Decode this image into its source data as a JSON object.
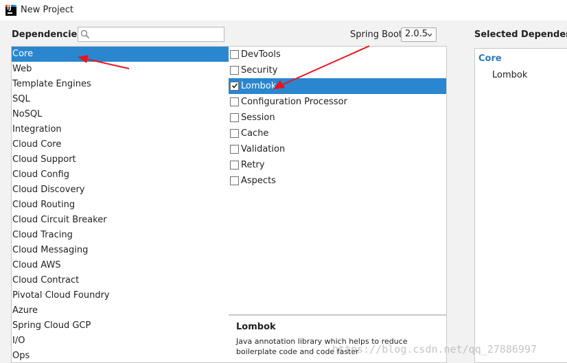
{
  "window": {
    "title": "New Project",
    "icon": "intellij-idea-icon"
  },
  "dependencies_label": "Dependencies",
  "search": {
    "value": "",
    "placeholder": ""
  },
  "spring_boot": {
    "label": "Spring Boot",
    "version": "2.0.5"
  },
  "selected_dependencies_label": "Selected Dependencies",
  "categories": [
    {
      "label": "Core",
      "selected": true
    },
    {
      "label": "Web"
    },
    {
      "label": "Template Engines"
    },
    {
      "label": "SQL"
    },
    {
      "label": "NoSQL"
    },
    {
      "label": "Integration"
    },
    {
      "label": "Cloud Core"
    },
    {
      "label": "Cloud Support"
    },
    {
      "label": "Cloud Config"
    },
    {
      "label": "Cloud Discovery"
    },
    {
      "label": "Cloud Routing"
    },
    {
      "label": "Cloud Circuit Breaker"
    },
    {
      "label": "Cloud Tracing"
    },
    {
      "label": "Cloud Messaging"
    },
    {
      "label": "Cloud AWS"
    },
    {
      "label": "Cloud Contract"
    },
    {
      "label": "Pivotal Cloud Foundry"
    },
    {
      "label": "Azure"
    },
    {
      "label": "Spring Cloud GCP"
    },
    {
      "label": "I/O"
    },
    {
      "label": "Ops"
    }
  ],
  "dependencies": [
    {
      "label": "DevTools",
      "checked": false
    },
    {
      "label": "Security",
      "checked": false
    },
    {
      "label": "Lombok",
      "checked": true,
      "selected": true
    },
    {
      "label": "Configuration Processor",
      "checked": false
    },
    {
      "label": "Session",
      "checked": false
    },
    {
      "label": "Cache",
      "checked": false
    },
    {
      "label": "Validation",
      "checked": false
    },
    {
      "label": "Retry",
      "checked": false
    },
    {
      "label": "Aspects",
      "checked": false
    }
  ],
  "description": {
    "title": "Lombok",
    "text": "Java annotation library which helps to reduce boilerplate code and code faster"
  },
  "selected_panel": {
    "group": "Core",
    "items": [
      "Lombok"
    ]
  },
  "watermark": "https://blog.csdn.net/qq_27886997",
  "colors": {
    "selection": "#2a86cf",
    "group_heading": "#2a7ab8",
    "annotation_arrow": "#e8141c"
  }
}
